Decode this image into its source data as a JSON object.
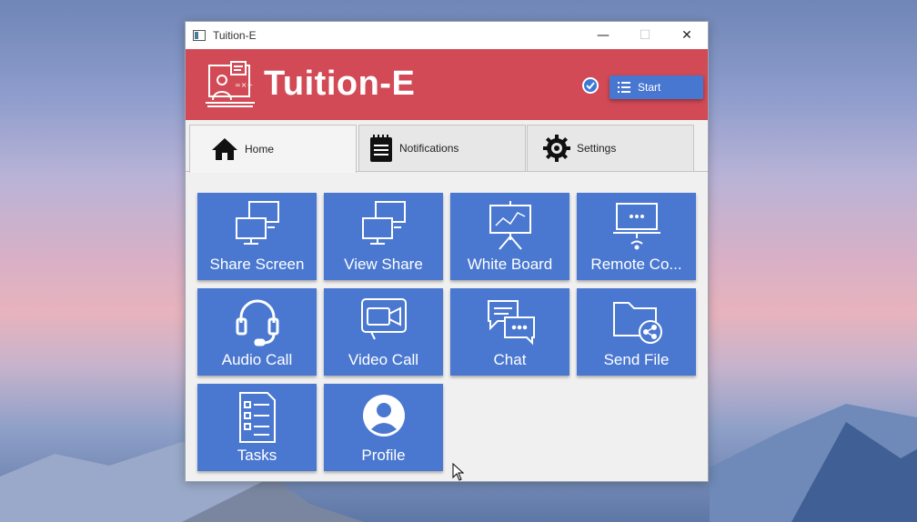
{
  "window": {
    "title": "Tuition-E"
  },
  "header": {
    "brand": "Tuition-E",
    "start_label": "Start"
  },
  "tabs": [
    {
      "label": "Home",
      "icon": "home-icon"
    },
    {
      "label": "Notifications",
      "icon": "notepad-icon"
    },
    {
      "label": "Settings",
      "icon": "gear-icon"
    }
  ],
  "tiles": [
    {
      "label": "Share Screen",
      "icon": "screens-icon"
    },
    {
      "label": "View Share",
      "icon": "screens-icon"
    },
    {
      "label": "White Board",
      "icon": "whiteboard-icon"
    },
    {
      "label": "Remote Co...",
      "icon": "remote-icon"
    },
    {
      "label": "Audio Call",
      "icon": "headset-icon"
    },
    {
      "label": "Video Call",
      "icon": "video-icon"
    },
    {
      "label": "Chat",
      "icon": "chat-icon"
    },
    {
      "label": "Send File",
      "icon": "folder-share-icon"
    },
    {
      "label": "Tasks",
      "icon": "checklist-icon"
    },
    {
      "label": "Profile",
      "icon": "profile-icon"
    }
  ],
  "colors": {
    "header": "#d24a55",
    "tile": "#4a78d0",
    "start_button": "#4877d2"
  }
}
